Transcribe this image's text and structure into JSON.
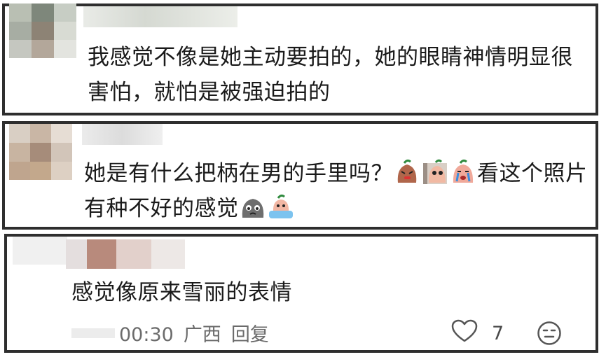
{
  "comments": [
    {
      "text": "我感觉不像是她主动要拍的，她的眼睛神情明显很害怕，就怕是被强迫拍的"
    },
    {
      "text_before": "她是有什么把柄在男的手里吗？",
      "emoji_a": [
        "angry-face-emoji",
        "peeking-face-emoji",
        "crying-face-emoji"
      ],
      "text_middle": "看这个照片有种不好的感觉",
      "emoji_b": [
        "gray-blob-emoji",
        "bathing-face-emoji"
      ]
    },
    {
      "text": "感觉像原来雪丽的表情",
      "time": "00:30",
      "location": "广西",
      "reply_label": "回复",
      "like_count": "7",
      "icons": {
        "like": "heart-outline-icon",
        "reaction": "neutral-face-icon"
      }
    }
  ],
  "colors": {
    "border": "#2e2e2e",
    "meta_text": "#6b6b6b"
  }
}
